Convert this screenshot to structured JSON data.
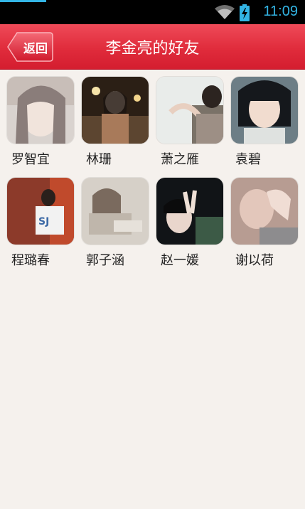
{
  "status_bar": {
    "time": "11:09",
    "accent_color": "#33b5e5"
  },
  "header": {
    "back_label": "返回",
    "title": "李金亮的好友",
    "bg_color": "#e02c3c"
  },
  "friends": [
    {
      "name": "罗智宜",
      "avatar_icon": "avatar-photo"
    },
    {
      "name": "林珊",
      "avatar_icon": "avatar-photo"
    },
    {
      "name": "萧之雁",
      "avatar_icon": "avatar-photo"
    },
    {
      "name": "袁碧",
      "avatar_icon": "avatar-photo"
    },
    {
      "name": "程璐春",
      "avatar_icon": "avatar-photo"
    },
    {
      "name": "郭子涵",
      "avatar_icon": "avatar-photo"
    },
    {
      "name": "赵一媛",
      "avatar_icon": "avatar-photo"
    },
    {
      "name": "谢以荷",
      "avatar_icon": "avatar-photo"
    }
  ]
}
